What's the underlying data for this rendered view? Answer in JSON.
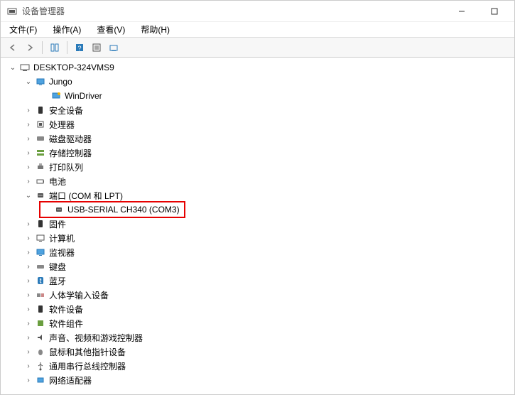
{
  "window": {
    "title": "设备管理器",
    "controls": {
      "minimize": "–",
      "maximize": "☐",
      "close": "✕"
    }
  },
  "menu": {
    "file": "文件(F)",
    "action": "操作(A)",
    "view": "查看(V)",
    "help": "帮助(H)"
  },
  "tree": {
    "root": "DESKTOP-324VMS9",
    "jungo": "Jungo",
    "windriver": "WinDriver",
    "security": "安全设备",
    "processors": "处理器",
    "diskdrives": "磁盘驱动器",
    "storage": "存储控制器",
    "printqueues": "打印队列",
    "batteries": "电池",
    "ports": "端口 (COM 和 LPT)",
    "usbserial": "USB-SERIAL CH340 (COM3)",
    "firmware": "固件",
    "computer": "计算机",
    "monitors": "监视器",
    "keyboards": "键盘",
    "bluetooth": "蓝牙",
    "hid": "人体学输入设备",
    "softdev": "软件设备",
    "softcomp": "软件组件",
    "sound": "声音、视频和游戏控制器",
    "mice": "鼠标和其他指针设备",
    "usb": "通用串行总线控制器",
    "network": "网络适配器"
  }
}
